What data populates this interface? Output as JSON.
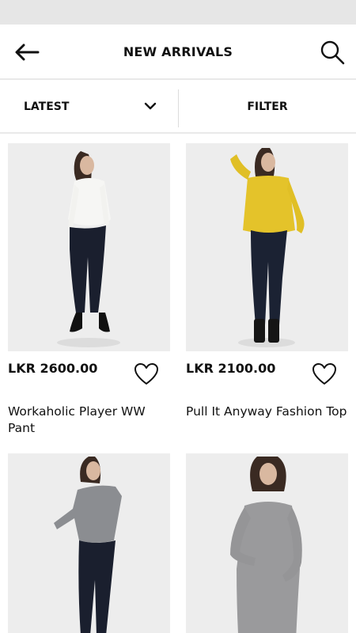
{
  "header": {
    "title": "NEW ARRIVALS",
    "back_icon": "arrow-left-icon",
    "search_icon": "search-icon"
  },
  "toolbar": {
    "sort_label": "LATEST",
    "sort_icon": "chevron-down-icon",
    "filter_label": "FILTER"
  },
  "colors": {
    "status_bar": "#e6e6e6",
    "image_bg": "#eeeeee",
    "text": "#111111"
  },
  "products": [
    {
      "price": "LKR 2600.00",
      "name": "Workaholic Player WW Pant",
      "wishlist_icon": "heart-outline-icon"
    },
    {
      "price": "LKR 2100.00",
      "name": "Pull It Anyway Fashion Top",
      "wishlist_icon": "heart-outline-icon"
    },
    {
      "price": "",
      "name": "",
      "wishlist_icon": "heart-outline-icon"
    },
    {
      "price": "",
      "name": "",
      "wishlist_icon": "heart-outline-icon"
    }
  ]
}
